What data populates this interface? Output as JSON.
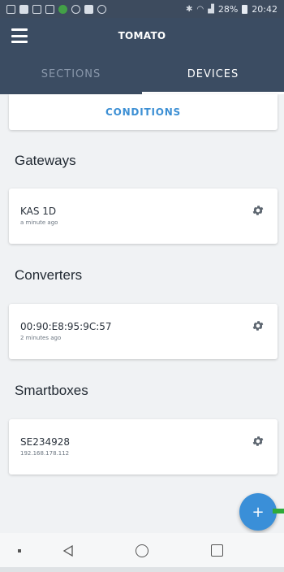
{
  "status_bar": {
    "signal_text": "28%",
    "time": "20:42",
    "icons": [
      "gallery-icon",
      "flag-icon",
      "image-icon",
      "mail-icon",
      "app-icon",
      "camera-icon",
      "video-icon",
      "record-icon"
    ]
  },
  "app_bar": {
    "title": "TOMATO",
    "menu_icon": "menu-icon"
  },
  "tabs": [
    {
      "label": "SECTIONS",
      "active": false
    },
    {
      "label": "DEVICES",
      "active": true
    }
  ],
  "conditions": {
    "label": "CONDITIONS"
  },
  "sections": [
    {
      "title": "Gateways",
      "devices": [
        {
          "name": "KAS 1D",
          "sub": "a minute ago"
        }
      ]
    },
    {
      "title": "Converters",
      "devices": [
        {
          "name": "00:90:E8:95:9C:57",
          "sub": "2 minutes ago"
        }
      ]
    },
    {
      "title": "Smartboxes",
      "devices": [
        {
          "name": "SE234928",
          "sub": "192.168.178.112"
        }
      ]
    }
  ],
  "fab": {
    "label": "+"
  },
  "colors": {
    "header": "#3b4c62",
    "accent": "#3c8fd4",
    "fab": "#3a8fd8"
  }
}
